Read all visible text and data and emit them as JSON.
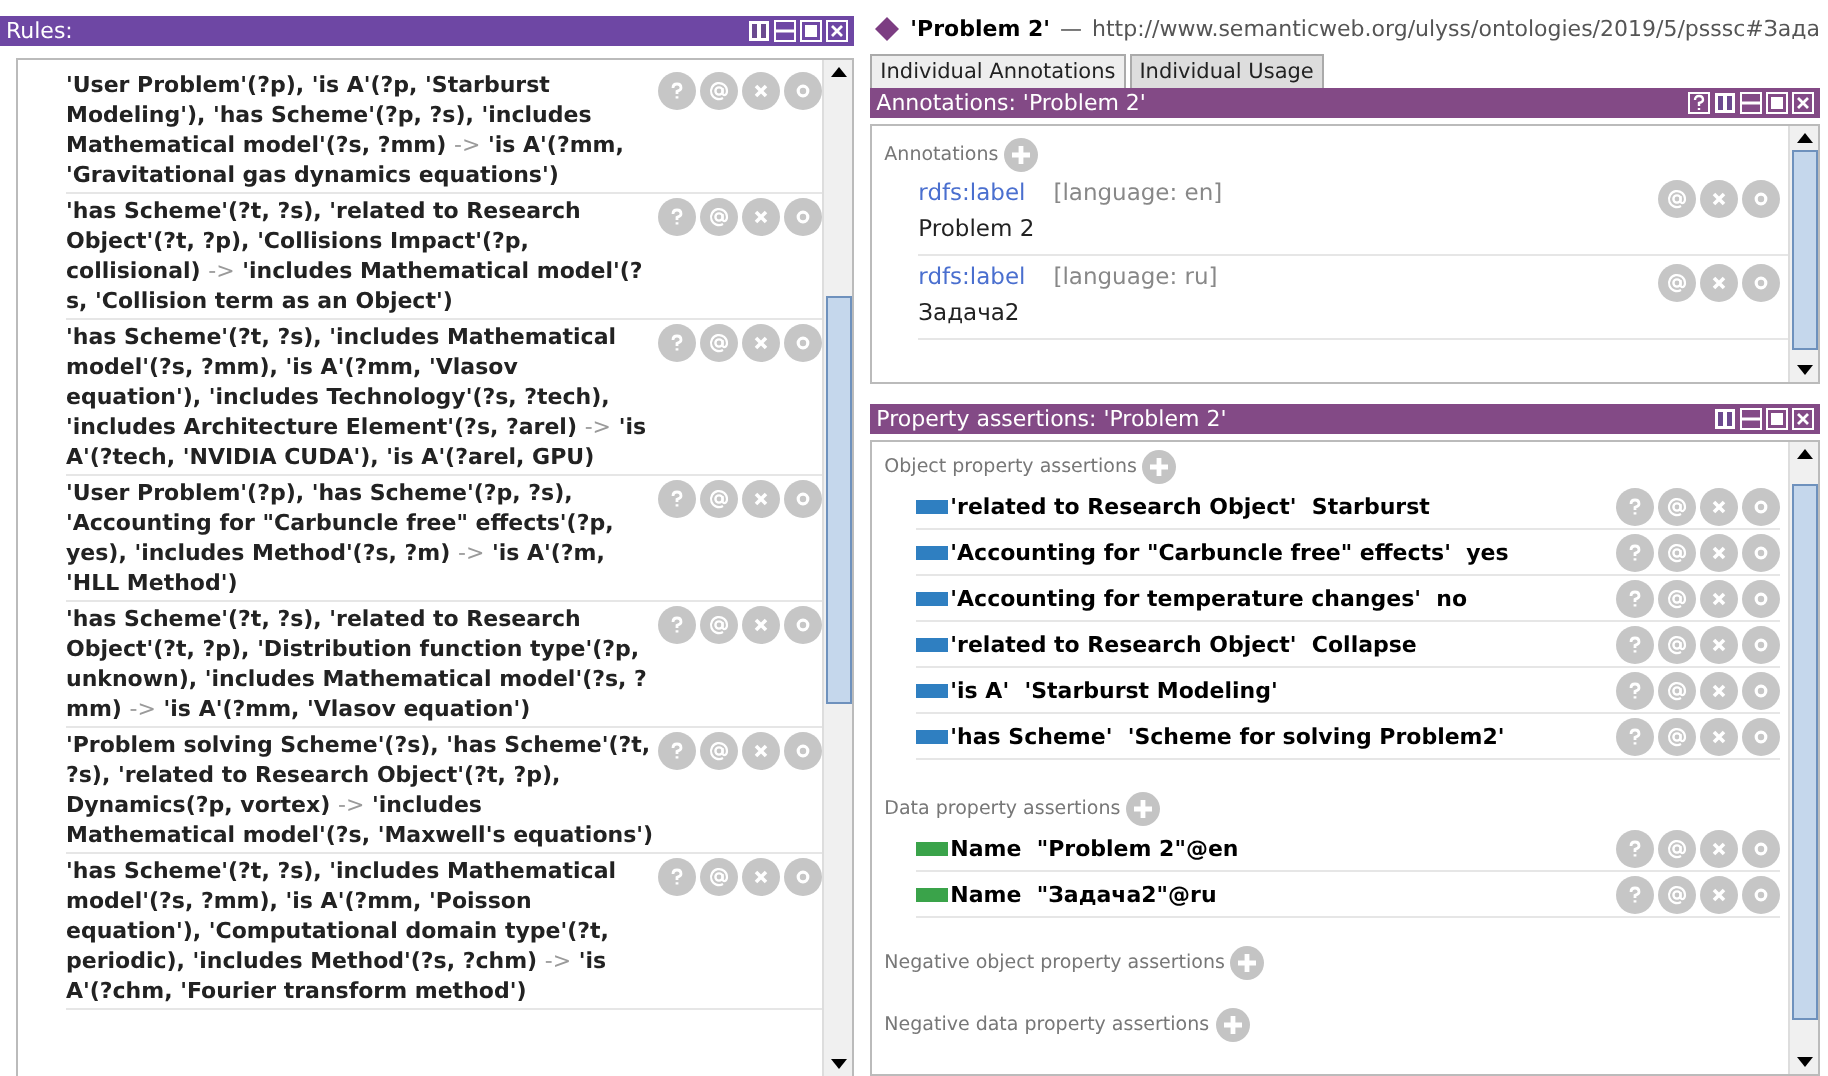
{
  "rules_panel": {
    "title": "Rules:",
    "rules": [
      {
        "body": "'User Problem'(?p), 'is A'(?p, 'Starburst Modeling'), 'has Scheme'(?p, ?s), 'includes Mathematical model'(?s, ?mm)",
        "arrow": "->",
        "head": "'is A'(?mm, 'Gravitational gas dynamics equations')"
      },
      {
        "body": "'has Scheme'(?t, ?s), 'related to Research Object'(?t, ?p), 'Collisions Impact'(?p, collisional)",
        "arrow": "->",
        "head": "'includes Mathematical model'(?s, 'Collision term as an Object')"
      },
      {
        "body": "'has Scheme'(?t, ?s), 'includes Mathematical model'(?s, ?mm), 'is A'(?mm, 'Vlasov equation'), 'includes Technology'(?s, ?tech), 'includes Architecture Element'(?s, ?arel)",
        "arrow": "->",
        "head": "'is A'(?tech, 'NVIDIA CUDA'), 'is A'(?arel, GPU)"
      },
      {
        "body": "'User Problem'(?p), 'has Scheme'(?p, ?s), 'Accounting for \"Carbuncle free\" effects'(?p, yes), 'includes Method'(?s, ?m)",
        "arrow": "->",
        "head": "'is A'(?m, 'HLL Method')"
      },
      {
        "body": "'has Scheme'(?t, ?s), 'related to Research Object'(?t, ?p), 'Distribution function type'(?p, unknown), 'includes Mathematical model'(?s, ?mm)",
        "arrow": "->",
        "head": "'is A'(?mm, 'Vlasov equation')"
      },
      {
        "body": "'Problem solving Scheme'(?s), 'has Scheme'(?t, ?s), 'related to Research Object'(?t, ?p), Dynamics(?p, vortex)",
        "arrow": "->",
        "head": "'includes Mathematical model'(?s, 'Maxwell's equations')"
      },
      {
        "body": "'has Scheme'(?t, ?s), 'includes Mathematical model'(?s, ?mm), 'is A'(?mm, 'Poisson equation'), 'Computational domain type'(?t, periodic), 'includes Method'(?s, ?chm)",
        "arrow": "->",
        "head": "'is A'(?chm, 'Fourier transform method')"
      }
    ]
  },
  "entity": {
    "name": "'Problem 2'",
    "separator": "—",
    "iri": "http://www.semanticweb.org/ulyss/ontologies/2019/5/psssc#Зада"
  },
  "tabs": [
    {
      "label": "Individual Annotations",
      "selected": true
    },
    {
      "label": "Individual Usage",
      "selected": false
    }
  ],
  "annotations_panel": {
    "title": "Annotations: 'Problem 2'",
    "section_label": "Annotations",
    "items": [
      {
        "property": "rdfs:label",
        "language": "[language: en]",
        "value": "Problem 2"
      },
      {
        "property": "rdfs:label",
        "language": "[language: ru]",
        "value": "Задача2"
      }
    ]
  },
  "property_panel": {
    "title": "Property assertions: 'Problem 2'",
    "sections": [
      {
        "label": "Object property assertions",
        "kind": "object",
        "items": [
          {
            "property": "'related to Research Object'",
            "value": "Starburst"
          },
          {
            "property": "'Accounting for \"Carbuncle free\" effects'",
            "value": "yes"
          },
          {
            "property": "'Accounting for temperature changes'",
            "value": "no"
          },
          {
            "property": "'related to Research Object'",
            "value": "Collapse"
          },
          {
            "property": "'is A'",
            "value": "'Starburst Modeling'"
          },
          {
            "property": "'has Scheme'",
            "value": "'Scheme for solving Problem2'"
          }
        ]
      },
      {
        "label": "Data property assertions",
        "kind": "data",
        "items": [
          {
            "property": "Name",
            "value": "\"Problem 2\"@en"
          },
          {
            "property": "Name",
            "value": "\"Задача2\"@ru"
          }
        ]
      },
      {
        "label": "Negative object property assertions"
      },
      {
        "label": "Negative data property assertions"
      }
    ]
  }
}
